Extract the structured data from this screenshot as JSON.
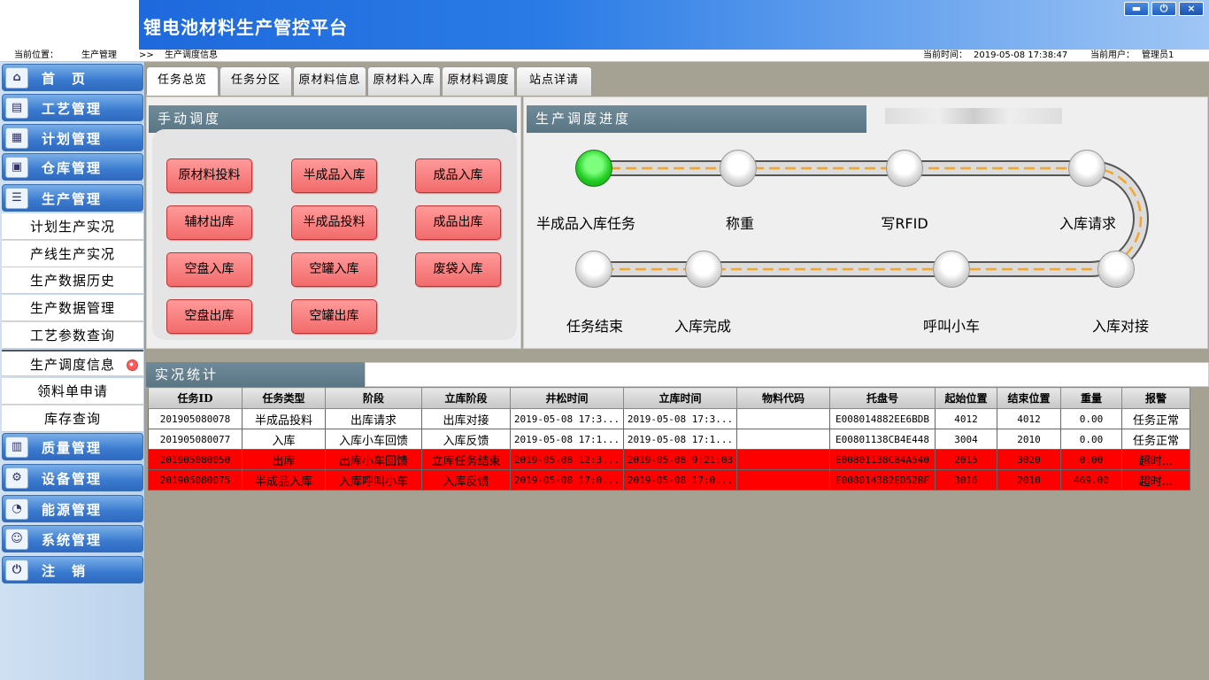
{
  "app": {
    "title": "锂电池材料生产管控平台"
  },
  "window": {
    "minimize_icon": "minus-icon",
    "power_icon": "power-icon",
    "close_label": "×"
  },
  "statusbar": {
    "location_label": "当前位置：",
    "crumb1": "生产管理",
    "sep": ">>",
    "crumb2": "生产调度信息",
    "time_label": "当前时间：",
    "time_value": "2019-05-08 17:38:47",
    "user_label": "当前用户：",
    "user_value": "管理员1"
  },
  "sidebar": {
    "home": "首　页",
    "craft": "工艺管理",
    "plan": "计划管理",
    "warehouse": "仓库管理",
    "production": "生产管理",
    "sub": [
      "计划生产实况",
      "产线生产实况",
      "生产数据历史",
      "生产数据管理",
      "工艺参数查询",
      "生产调度信息",
      "领料单申请",
      "库存查询"
    ],
    "quality": "质量管理",
    "equipment": "设备管理",
    "energy": "能源管理",
    "system": "系统管理",
    "logout": "注　销"
  },
  "tabs": [
    "任务总览",
    "任务分区",
    "原材料信息",
    "原材料入库",
    "原材料调度",
    "站点详请"
  ],
  "manual": {
    "title": "手动调度",
    "buttons": [
      "原材料投料",
      "半成品入库",
      "成品入库",
      "辅材出库",
      "半成品投料",
      "成品出库",
      "空盘入库",
      "空罐入库",
      "废袋入库",
      "空盘出库",
      "空罐出库"
    ]
  },
  "progress": {
    "title": "生产调度进度",
    "stations": [
      "半成品入库任务",
      "称重",
      "写RFID",
      "入库请求",
      "任务结束",
      "入库完成",
      "呼叫小车",
      "入库对接"
    ],
    "active_index": 0
  },
  "stats": {
    "title": "实况统计",
    "columns": [
      "任务ID",
      "任务类型",
      "阶段",
      "立库阶段",
      "井松时间",
      "立库时间",
      "物料代码",
      "托盘号",
      "起始位置",
      "结束位置",
      "重量",
      "报警"
    ],
    "rows": [
      {
        "alarm": false,
        "cells": [
          "201905080078",
          "半成品投料",
          "出库请求",
          "出库对接",
          "2019-05-08 17:3...",
          "2019-05-08 17:3...",
          "",
          "E008014882EE6BDB",
          "4012",
          "4012",
          "0.00",
          "任务正常"
        ]
      },
      {
        "alarm": false,
        "cells": [
          "201905080077",
          "入库",
          "入库小车回馈",
          "入库反馈",
          "2019-05-08 17:1...",
          "2019-05-08 17:1...",
          "",
          "E00801138CB4E448",
          "3004",
          "2010",
          "0.00",
          "任务正常"
        ]
      },
      {
        "alarm": true,
        "cells": [
          "201905080050",
          "出库",
          "出库小车回馈",
          "立库任务结束",
          "2019-05-08 12:3...",
          "2019-05-08 9:21:03",
          "",
          "E00801138CB4A540",
          "2015",
          "3020",
          "0.00",
          "超时..."
        ]
      },
      {
        "alarm": true,
        "cells": [
          "201905080075",
          "半成品入库",
          "入库呼叫小车",
          "入库反馈",
          "2019-05-08 17:0...",
          "2019-05-08 17:0...",
          "",
          "E008014382ED52BF",
          "3016",
          "2010",
          "469.00",
          "超时..."
        ]
      }
    ]
  },
  "colors": {
    "alarm_row": "#ff0000",
    "active_station": "#22cc22",
    "track_dash": "#f4a52a",
    "header_blue": "#1a63d8"
  }
}
